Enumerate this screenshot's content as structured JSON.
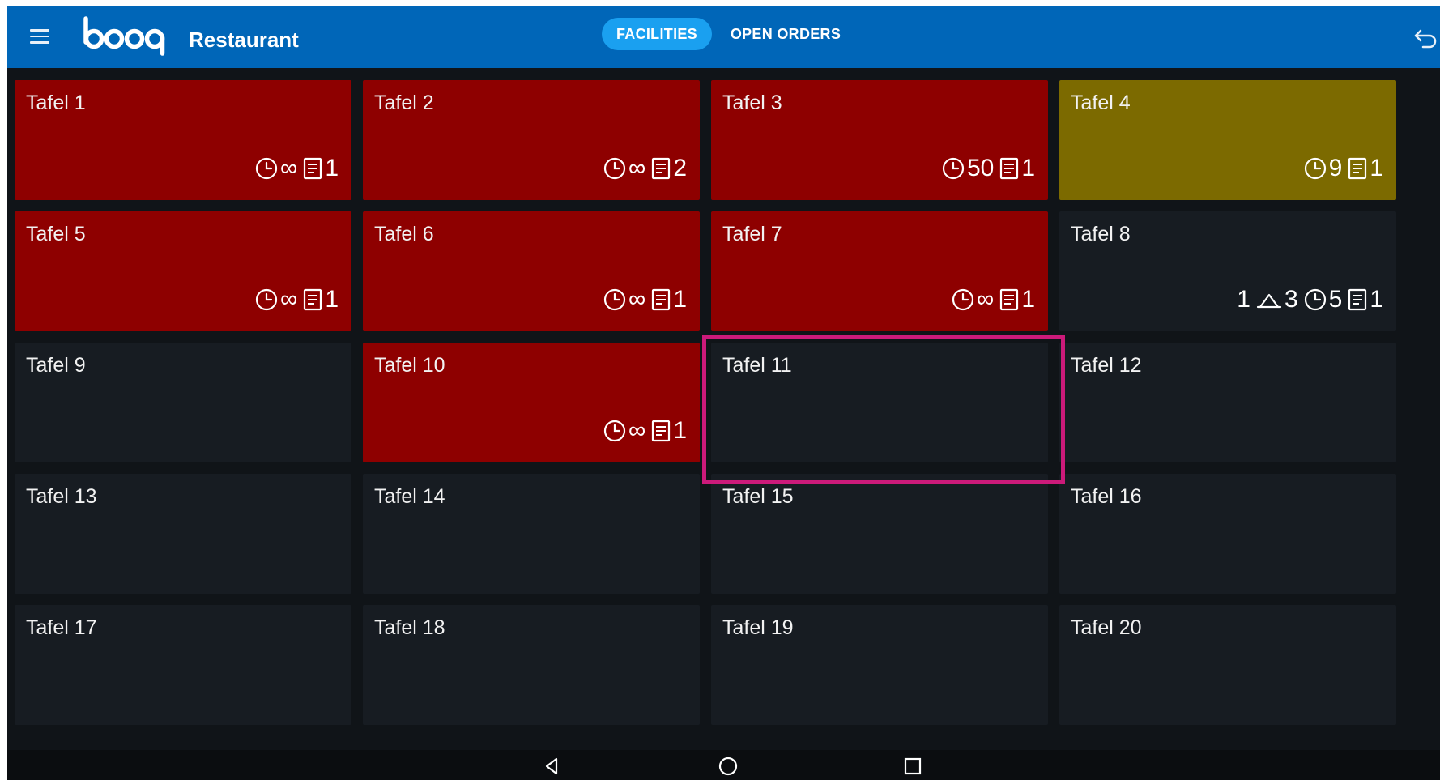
{
  "app": {
    "title": "Restaurant",
    "logo_text": "booq"
  },
  "tabs": [
    {
      "label": "FACILITIES",
      "active": true
    },
    {
      "label": "OPEN ORDERS",
      "active": false
    }
  ],
  "icons": {
    "menu": "hamburger-menu-icon",
    "back": "undo-back-arrow-icon",
    "clock": "clock-icon",
    "receipt": "receipt-icon",
    "course": "cloche-icon",
    "nav_back": "triangle-back-icon",
    "nav_home": "circle-home-icon",
    "nav_recent": "square-recents-icon"
  },
  "colors": {
    "topbar": "#0066b8",
    "active_tab": "#1aa0f0",
    "occupied": "#8e0000",
    "warning": "#7c6a00",
    "free": "#171c22",
    "highlight": "#cc1a7a"
  },
  "tables": [
    {
      "name": "Tafel 1",
      "status": "occupied",
      "time": "∞",
      "orders": "1"
    },
    {
      "name": "Tafel 2",
      "status": "occupied",
      "time": "∞",
      "orders": "2"
    },
    {
      "name": "Tafel 3",
      "status": "occupied",
      "time": "50",
      "orders": "1"
    },
    {
      "name": "Tafel 4",
      "status": "warning",
      "time": "9",
      "orders": "1"
    },
    {
      "name": "Tafel 5",
      "status": "occupied",
      "time": "∞",
      "orders": "1"
    },
    {
      "name": "Tafel 6",
      "status": "occupied",
      "time": "∞",
      "orders": "1"
    },
    {
      "name": "Tafel 7",
      "status": "occupied",
      "time": "∞",
      "orders": "1"
    },
    {
      "name": "Tafel 8",
      "status": "free",
      "course_pre": "1",
      "course": "3",
      "time": "5",
      "orders": "1"
    },
    {
      "name": "Tafel 9",
      "status": "free"
    },
    {
      "name": "Tafel 10",
      "status": "occupied",
      "time": "∞",
      "orders": "1"
    },
    {
      "name": "Tafel 11",
      "status": "free",
      "highlighted": true
    },
    {
      "name": "Tafel 12",
      "status": "free"
    },
    {
      "name": "Tafel 13",
      "status": "free"
    },
    {
      "name": "Tafel 14",
      "status": "free"
    },
    {
      "name": "Tafel 15",
      "status": "free"
    },
    {
      "name": "Tafel 16",
      "status": "free"
    },
    {
      "name": "Tafel 17",
      "status": "free"
    },
    {
      "name": "Tafel 18",
      "status": "free"
    },
    {
      "name": "Tafel 19",
      "status": "free"
    },
    {
      "name": "Tafel 20",
      "status": "free"
    }
  ]
}
